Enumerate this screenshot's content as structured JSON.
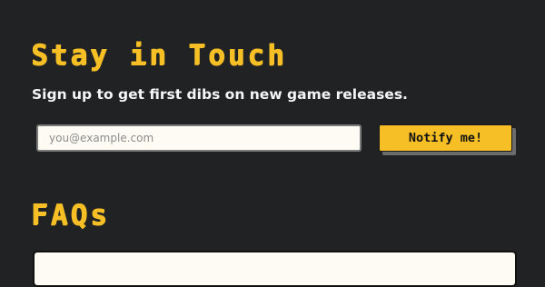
{
  "signup": {
    "title": "Stay in Touch",
    "tagline": "Sign up to get first dibs on new game releases.",
    "email_placeholder": "you@example.com",
    "button_label": "Notify me!"
  },
  "faq": {
    "title": "FAQs"
  },
  "colors": {
    "background": "#212223",
    "accent": "#f6bf26",
    "input_background": "#fdfbf3",
    "button_shadow": "#6b6b6b"
  }
}
